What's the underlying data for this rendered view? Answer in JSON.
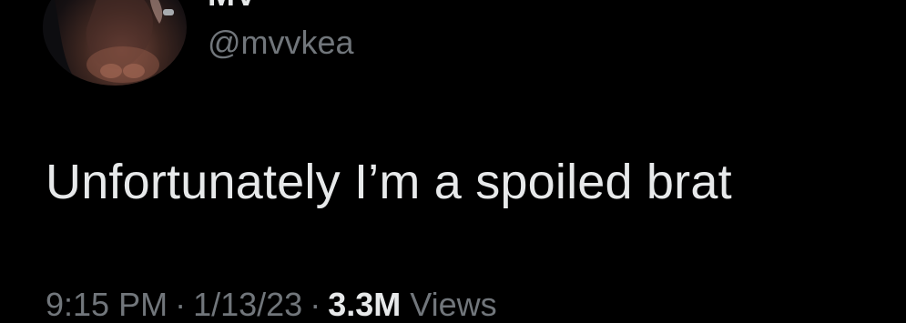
{
  "tweet": {
    "author": {
      "display_name": "MV",
      "handle": "@mvvkea",
      "avatar_icon": "profile-photo"
    },
    "text": "Unfortunately I’m a spoiled brat",
    "meta": {
      "time": "9:15 PM",
      "date": "1/13/23",
      "views_count": "3.3M",
      "views_label": "Views",
      "separator": "·"
    }
  },
  "colors": {
    "background": "#000000",
    "primary_text": "#e7e9ea",
    "secondary_text": "#71767b"
  }
}
